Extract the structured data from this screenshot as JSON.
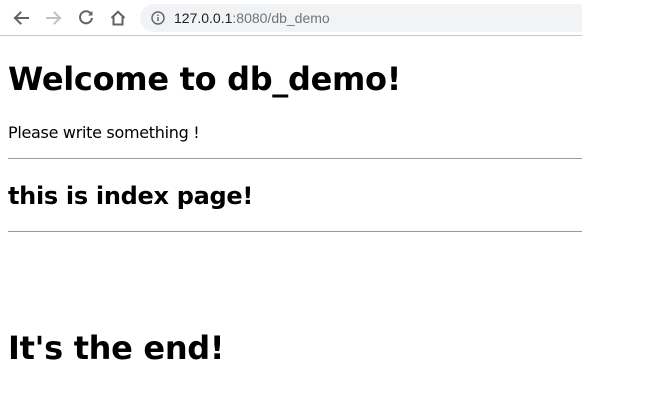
{
  "browser": {
    "nav_buttons": {
      "back_icon": "arrow-left-icon",
      "forward_icon": "arrow-right-icon",
      "reload_icon": "reload-icon",
      "home_icon": "home-icon"
    },
    "address_bar": {
      "security_icon": "info-icon",
      "url_host": "127.0.0.1",
      "url_rest": ":8080/db_demo"
    },
    "colors": {
      "icon_active": "#5f6368",
      "icon_disabled": "#bdc1c6",
      "omnibox_bg": "#f1f3f4"
    }
  },
  "page": {
    "welcome_heading": "Welcome to db_demo!",
    "intro_text": "Please write something !",
    "index_heading": "this is index page!",
    "end_heading": "It's the end!"
  }
}
